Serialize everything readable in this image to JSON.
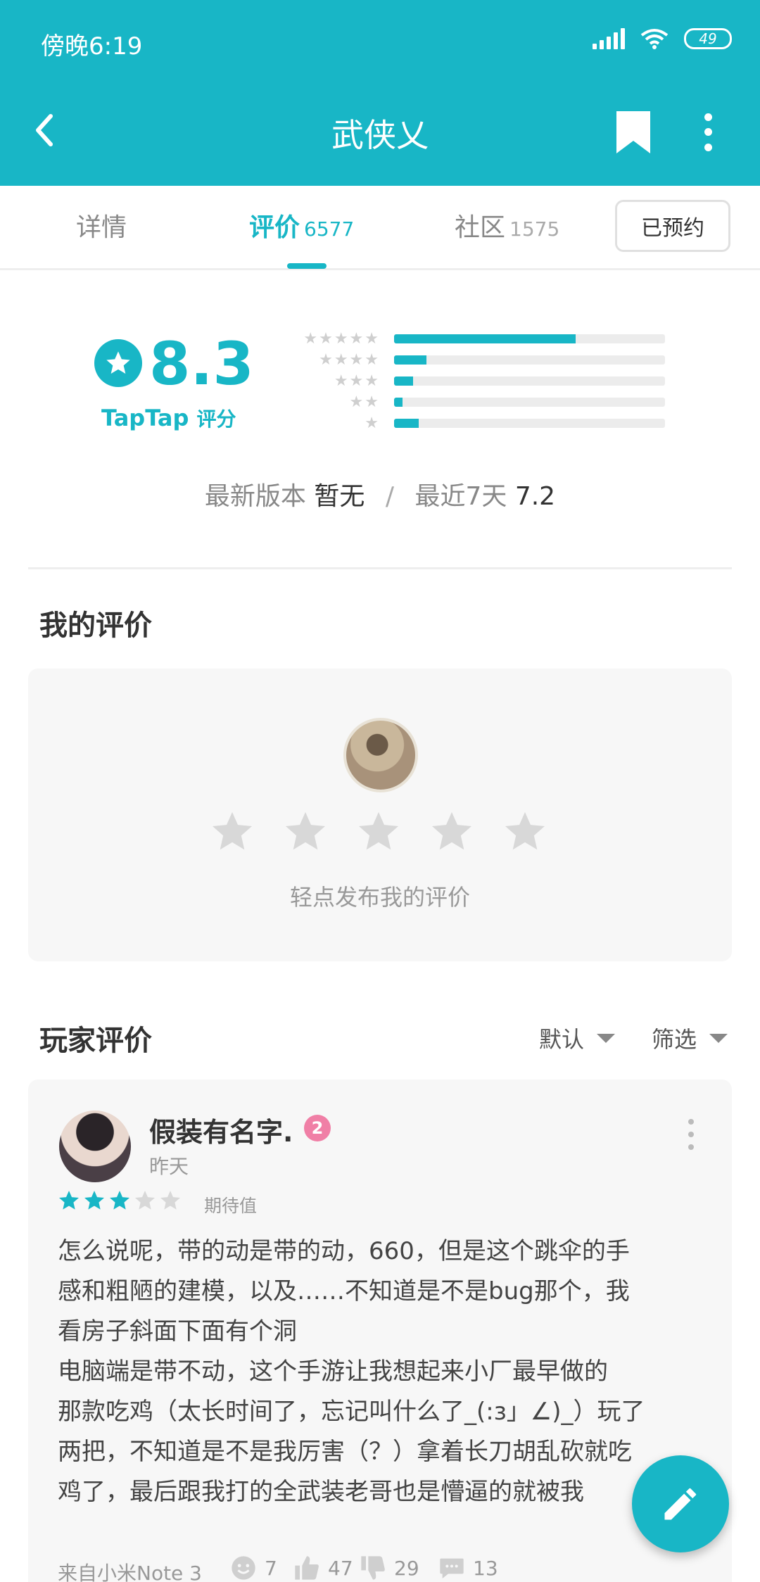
{
  "status_bar": {
    "time": "傍晚6:19",
    "battery": "49"
  },
  "header": {
    "title": "武侠乂"
  },
  "tabs": [
    {
      "label": "详情",
      "count": ""
    },
    {
      "label": "评价",
      "count": "6577"
    },
    {
      "label": "社区",
      "count": "1575"
    }
  ],
  "reserve_button": "已预约",
  "rating": {
    "score": "8.3",
    "brand": "TapTap",
    "label": "评分",
    "distribution": [
      {
        "stars": 5,
        "fraction": 0.67
      },
      {
        "stars": 4,
        "fraction": 0.12
      },
      {
        "stars": 3,
        "fraction": 0.07
      },
      {
        "stars": 2,
        "fraction": 0.03
      },
      {
        "stars": 1,
        "fraction": 0.09
      }
    ],
    "latest_version_label": "最新版本",
    "latest_version_value": "暂无",
    "separator": "/",
    "recent_label": "最近7天",
    "recent_value": "7.2"
  },
  "my_review": {
    "title": "我的评价",
    "hint": "轻点发布我的评价"
  },
  "player_reviews": {
    "title": "玩家评价",
    "sort": "默认",
    "filter": "筛选"
  },
  "review": {
    "author": "假装有名字.",
    "level": "2",
    "date": "昨天",
    "stars": 3,
    "tag": "期待值",
    "lines": [
      "怎么说呢，带的动是带的动，660，但是这个跳伞的手",
      "感和粗陋的建模，以及……不知道是不是bug那个，我",
      "看房子斜面下面有个洞",
      "电脑端是带不动，这个手游让我想起来小厂最早做的",
      "那款吃鸡（太长时间了，忘记叫什么了_(:з」∠)_）玩了",
      "两把，不知道是不是我厉害（？）拿着长刀胡乱砍就吃",
      "鸡了，最后跟我打的全武装老哥也是懵逼的就被我"
    ],
    "device": "来自小米Note 3",
    "funny": "7",
    "likes": "47",
    "dislikes": "29",
    "comments": "13"
  },
  "colors": {
    "accent": "#18b6c6",
    "level_badge": "#f07fa6"
  }
}
